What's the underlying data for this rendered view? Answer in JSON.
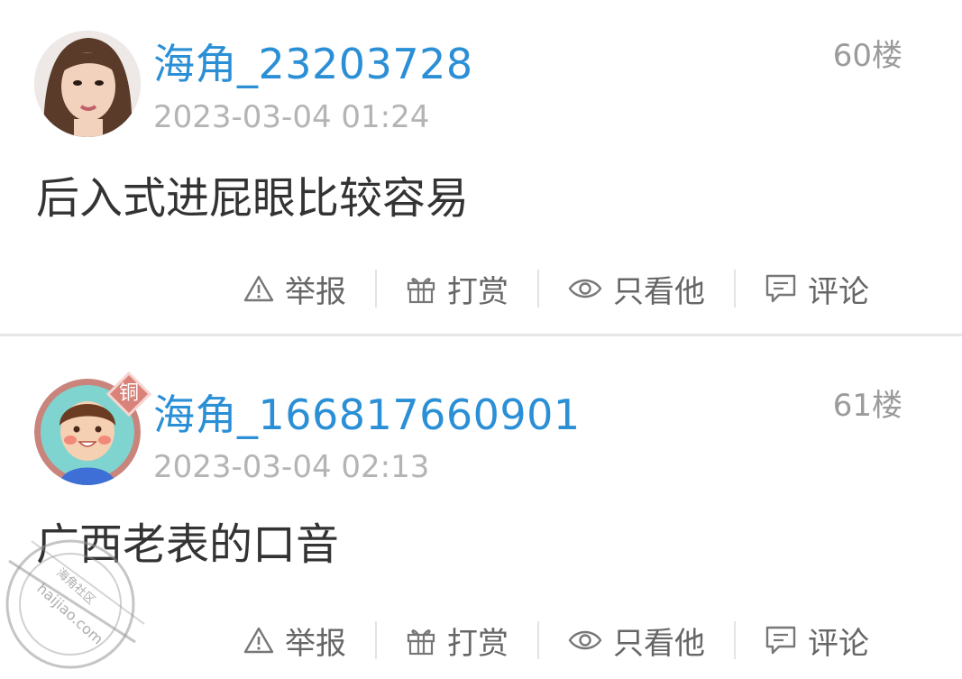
{
  "posts": [
    {
      "username": "海角_23203728",
      "time": "2023-03-04 01:24",
      "floor": "60楼",
      "content": "后入式进屁眼比较容易",
      "avatar": "photo-avatar",
      "badge": null
    },
    {
      "username": "海角_166817660901",
      "time": "2023-03-04 02:13",
      "floor": "61楼",
      "content": "广西老表的口音",
      "avatar": "cartoon-avatar",
      "badge": "铜"
    }
  ],
  "actions": {
    "report": "举报",
    "reward": "打赏",
    "only_him": "只看他",
    "comment": "评论"
  },
  "icons": [
    "warning-icon",
    "gift-icon",
    "eye-icon",
    "comment-icon"
  ],
  "watermark": {
    "site": "haijiao.com",
    "name": "海角社区"
  },
  "colors": {
    "username": "#2b8fd6",
    "time": "#b4b4b4",
    "badge": "#d9827a"
  }
}
